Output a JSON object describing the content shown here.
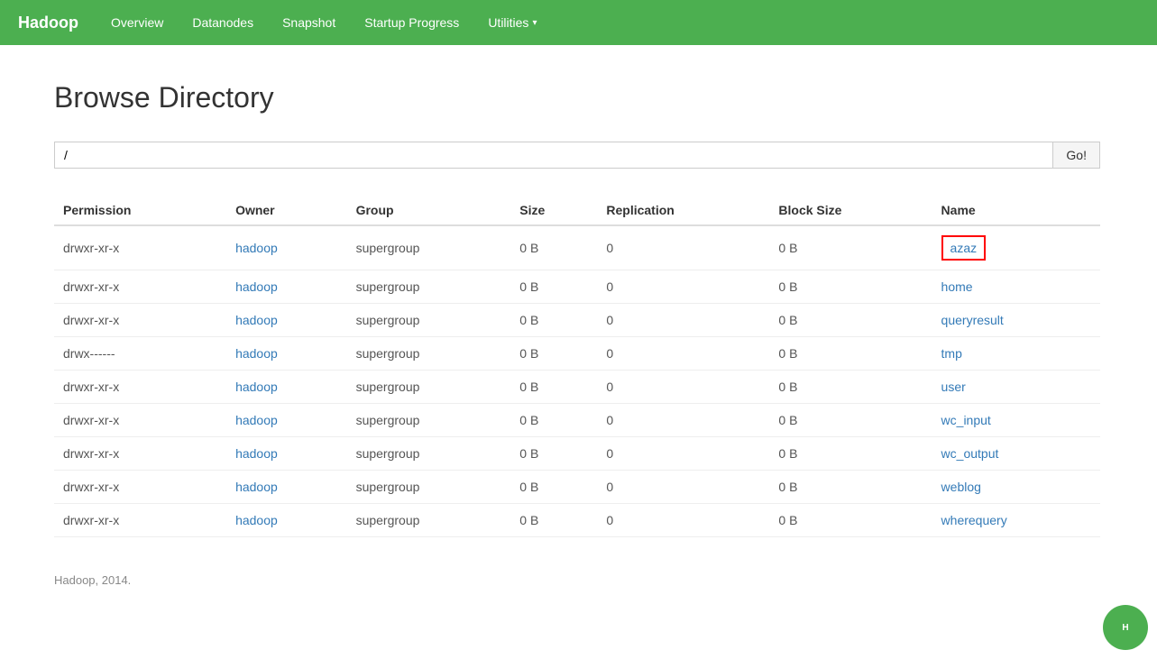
{
  "navbar": {
    "brand": "Hadoop",
    "links": [
      {
        "label": "Overview",
        "href": "#"
      },
      {
        "label": "Datanodes",
        "href": "#"
      },
      {
        "label": "Snapshot",
        "href": "#"
      },
      {
        "label": "Startup Progress",
        "href": "#"
      },
      {
        "label": "Utilities",
        "href": "#",
        "dropdown": true
      }
    ]
  },
  "page": {
    "title": "Browse Directory"
  },
  "search": {
    "placeholder": "",
    "value": "/",
    "button_label": "Go!"
  },
  "table": {
    "columns": [
      "Permission",
      "Owner",
      "Group",
      "Size",
      "Replication",
      "Block Size",
      "Name"
    ],
    "rows": [
      {
        "permission": "drwxr-xr-x",
        "owner": "hadoop",
        "group": "supergroup",
        "size": "0 B",
        "replication": "0",
        "block_size": "0 B",
        "name": "azaz",
        "highlighted": true
      },
      {
        "permission": "drwxr-xr-x",
        "owner": "hadoop",
        "group": "supergroup",
        "size": "0 B",
        "replication": "0",
        "block_size": "0 B",
        "name": "home",
        "highlighted": false
      },
      {
        "permission": "drwxr-xr-x",
        "owner": "hadoop",
        "group": "supergroup",
        "size": "0 B",
        "replication": "0",
        "block_size": "0 B",
        "name": "queryresult",
        "highlighted": false
      },
      {
        "permission": "drwx------",
        "owner": "hadoop",
        "group": "supergroup",
        "size": "0 B",
        "replication": "0",
        "block_size": "0 B",
        "name": "tmp",
        "highlighted": false
      },
      {
        "permission": "drwxr-xr-x",
        "owner": "hadoop",
        "group": "supergroup",
        "size": "0 B",
        "replication": "0",
        "block_size": "0 B",
        "name": "user",
        "highlighted": false
      },
      {
        "permission": "drwxr-xr-x",
        "owner": "hadoop",
        "group": "supergroup",
        "size": "0 B",
        "replication": "0",
        "block_size": "0 B",
        "name": "wc_input",
        "highlighted": false
      },
      {
        "permission": "drwxr-xr-x",
        "owner": "hadoop",
        "group": "supergroup",
        "size": "0 B",
        "replication": "0",
        "block_size": "0 B",
        "name": "wc_output",
        "highlighted": false
      },
      {
        "permission": "drwxr-xr-x",
        "owner": "hadoop",
        "group": "supergroup",
        "size": "0 B",
        "replication": "0",
        "block_size": "0 B",
        "name": "weblog",
        "highlighted": false
      },
      {
        "permission": "drwxr-xr-x",
        "owner": "hadoop",
        "group": "supergroup",
        "size": "0 B",
        "replication": "0",
        "block_size": "0 B",
        "name": "wherequery",
        "highlighted": false
      }
    ]
  },
  "footer": {
    "text": "Hadoop, 2014."
  }
}
